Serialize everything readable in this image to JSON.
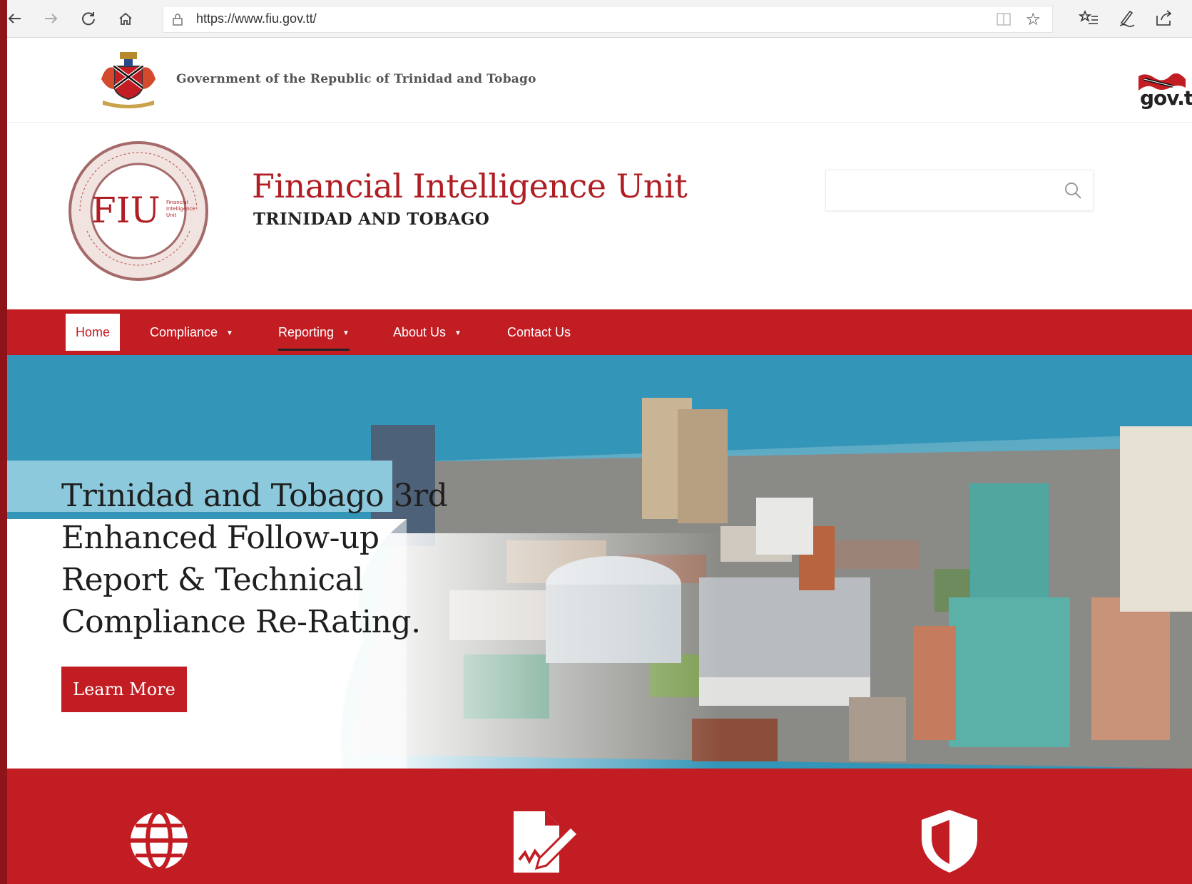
{
  "browser": {
    "url": "https://www.fiu.gov.tt/",
    "icons": [
      "back-icon",
      "forward-icon",
      "refresh-icon",
      "home-icon",
      "lock-icon",
      "reading-view-icon",
      "favorite-star-icon",
      "favorites-list-icon",
      "pen-icon",
      "share-icon"
    ]
  },
  "govbar": {
    "text": "Government of the Republic of Trinidad and Tobago",
    "govtt_logo_text": "gov.tt"
  },
  "header": {
    "title": "Financial Intelligence Unit",
    "subtitle": "TRINIDAD AND TOBAGO",
    "search_placeholder": ""
  },
  "nav": {
    "items": [
      {
        "label": "Home",
        "active": true,
        "dropdown": false
      },
      {
        "label": "Compliance",
        "active": false,
        "dropdown": true
      },
      {
        "label": "Reporting",
        "active": false,
        "dropdown": true
      },
      {
        "label": "About Us",
        "active": false,
        "dropdown": true
      },
      {
        "label": "Contact Us",
        "active": false,
        "dropdown": false
      }
    ]
  },
  "hero": {
    "title_lines": [
      "Trinidad and Tobago 3rd",
      "Enhanced Follow-up",
      "Report & Technical",
      "Compliance Re-Rating."
    ],
    "button": "Learn More"
  },
  "features": {
    "icons": [
      "globe-icon",
      "document-signature-icon",
      "shield-icon"
    ]
  },
  "colors": {
    "brand_red": "#c31d24",
    "sky_blue": "#3395b8",
    "band_blue": "#8cc9dc",
    "outer_border": "#8e1419"
  }
}
